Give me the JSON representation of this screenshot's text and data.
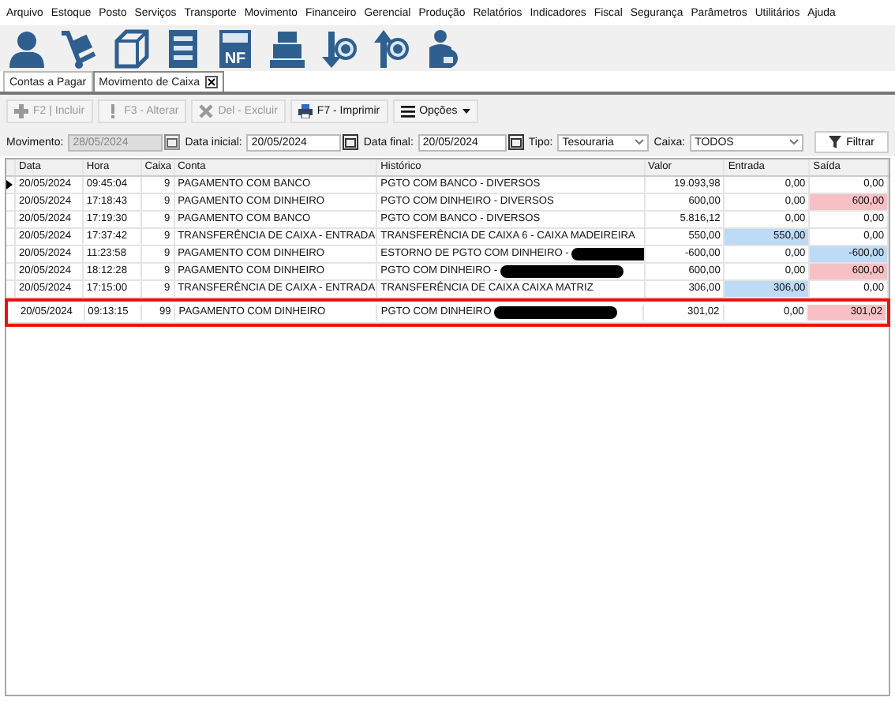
{
  "menu": [
    "Arquivo",
    "Estoque",
    "Posto",
    "Serviços",
    "Transporte",
    "Movimento",
    "Financeiro",
    "Gerencial",
    "Produção",
    "Relatórios",
    "Indicadores",
    "Fiscal",
    "Segurança",
    "Parâmetros",
    "Utilitários",
    "Ajuda"
  ],
  "toolbar_icons": [
    {
      "kind": "person"
    },
    {
      "kind": "cart"
    },
    {
      "kind": "box"
    },
    {
      "kind": "form"
    },
    {
      "kind": "nf",
      "label": "NF"
    },
    {
      "kind": "register"
    },
    {
      "kind": "money-down"
    },
    {
      "kind": "money-up"
    },
    {
      "kind": "lock-person"
    }
  ],
  "tabs": [
    {
      "label": "Contas a Pagar",
      "selected": false,
      "closable": false
    },
    {
      "label": "Movimento de Caixa",
      "selected": true,
      "closable": true
    }
  ],
  "actions": [
    {
      "label": "F2 | Incluir",
      "kind": "plus",
      "disabled": true
    },
    {
      "label": "F3 - Alterar",
      "kind": "bang",
      "disabled": true
    },
    {
      "label": "Del - Excluir",
      "kind": "x",
      "disabled": true
    },
    {
      "label": "F7 - Imprimir",
      "kind": "printer",
      "disabled": false
    },
    {
      "label": "Opções",
      "kind": "menu",
      "disabled": false
    }
  ],
  "filters": {
    "movimento_label": "Movimento:",
    "movimento": "28/05/2024",
    "movimento_disabled": true,
    "data_inicial_label": "Data inicial:",
    "data_inicial": "20/05/2024",
    "data_final_label": "Data final:",
    "data_final": "20/05/2024",
    "tipo_label": "Tipo:",
    "tipo": "Tesouraria",
    "caixa_label": "Caixa:",
    "caixa": "TODOS",
    "filter_button": "Filtrar"
  },
  "table": {
    "columns": [
      "Data",
      "Hora",
      "Caixa",
      "Conta",
      "Histórico",
      "Valor",
      "Entrada",
      "Saída"
    ],
    "rows": [
      {
        "current": true,
        "marked": false,
        "data": "20/05/2024",
        "hora": "09:45:04",
        "caixa": "9",
        "conta": "PAGAMENTO COM BANCO",
        "historico": "PGTO COM BANCO - DIVERSOS",
        "redacted": false,
        "valor": "19.093,98",
        "entrada": {
          "value": "0,00"
        },
        "saida": {
          "value": "0,00"
        }
      },
      {
        "current": false,
        "marked": false,
        "data": "20/05/2024",
        "hora": "17:18:43",
        "caixa": "9",
        "conta": "PAGAMENTO COM DINHEIRO",
        "historico": "PGTO COM DINHEIRO - DIVERSOS",
        "redacted": false,
        "valor": "600,00",
        "entrada": {
          "value": "0,00"
        },
        "saida": {
          "value": "600,00",
          "color": "#f7c0c4"
        }
      },
      {
        "current": false,
        "marked": false,
        "data": "20/05/2024",
        "hora": "17:19:30",
        "caixa": "9",
        "conta": "PAGAMENTO COM BANCO",
        "historico": "PGTO COM BANCO - DIVERSOS",
        "redacted": false,
        "valor": "5.816,12",
        "entrada": {
          "value": "0,00"
        },
        "saida": {
          "value": "0,00"
        }
      },
      {
        "current": false,
        "marked": false,
        "data": "20/05/2024",
        "hora": "17:37:42",
        "caixa": "9",
        "conta": "TRANSFERÊNCIA DE CAIXA - ENTRADA",
        "historico": "TRANSFERÊNCIA DE CAIXA 6 - CAIXA MADEIREIRA",
        "redacted": false,
        "valor": "550,00",
        "entrada": {
          "value": "550,00",
          "color": "#bddaf6"
        },
        "saida": {
          "value": "0,00"
        }
      },
      {
        "current": false,
        "marked": false,
        "data": "20/05/2024",
        "hora": "11:23:58",
        "caixa": "9",
        "conta": "PAGAMENTO COM DINHEIRO",
        "historico": "ESTORNO DE PGTO COM DINHEIRO -",
        "redacted": true,
        "valor": "-600,00",
        "entrada": {
          "value": "0,00"
        },
        "saida": {
          "value": "-600,00",
          "color": "#bddaf6"
        }
      },
      {
        "current": false,
        "marked": false,
        "data": "20/05/2024",
        "hora": "18:12:28",
        "caixa": "9",
        "conta": "PAGAMENTO COM DINHEIRO",
        "historico": "PGTO COM DINHEIRO -",
        "redacted": true,
        "valor": "600,00",
        "entrada": {
          "value": "0,00"
        },
        "saida": {
          "value": "600,00",
          "color": "#f7c0c4"
        }
      },
      {
        "current": false,
        "marked": false,
        "data": "20/05/2024",
        "hora": "17:15:00",
        "caixa": "9",
        "conta": "TRANSFERÊNCIA DE CAIXA - ENTRADA",
        "historico": "TRANSFERÊNCIA DE CAIXA CAIXA MATRIZ",
        "redacted": false,
        "valor": "306,00",
        "entrada": {
          "value": "306,00",
          "color": "#bddaf6"
        },
        "saida": {
          "value": "0,00"
        }
      },
      {
        "current": false,
        "marked": true,
        "data": "20/05/2024",
        "hora": "09:13:15",
        "caixa": "99",
        "conta": "PAGAMENTO COM DINHEIRO",
        "historico": "PGTO COM DINHEIRO",
        "redacted": true,
        "valor": "301,02",
        "entrada": {
          "value": "0,00"
        },
        "saida": {
          "value": "301,02",
          "color": "#f7c0c4"
        }
      }
    ]
  }
}
